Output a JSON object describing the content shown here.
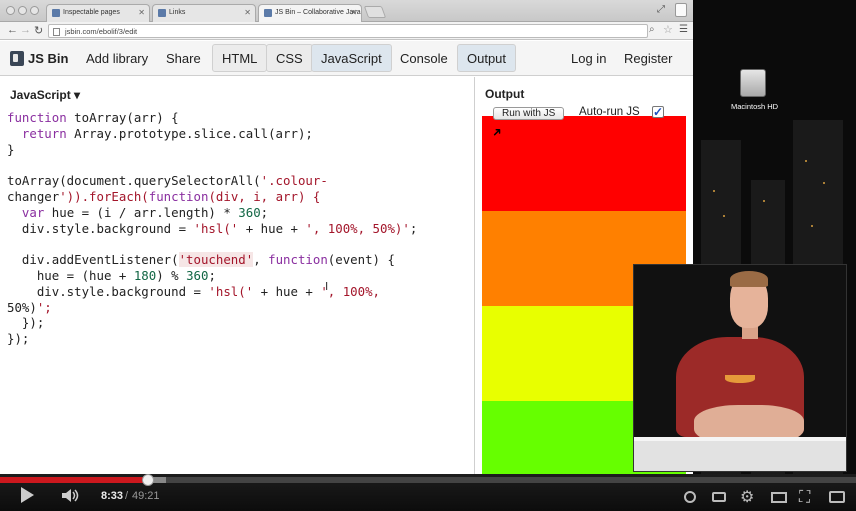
{
  "browser": {
    "tabs": [
      {
        "label": "Inspectable pages"
      },
      {
        "label": "Links"
      },
      {
        "label": "JS Bin – Collaborative Java"
      }
    ],
    "url": "jsbin.com/ebolif/3/edit"
  },
  "jsbin": {
    "logo": "JS Bin",
    "add_library": "Add library",
    "share": "Share",
    "panels": [
      "HTML",
      "CSS",
      "JavaScript",
      "Console",
      "Output"
    ],
    "active_panel": "JavaScript",
    "login": "Log in",
    "register": "Register"
  },
  "editor": {
    "label": "JavaScript ▾",
    "code_lines": [
      "function toArray(arr) {",
      "  return Array.prototype.slice.call(arr);",
      "}",
      "",
      "toArray(document.querySelectorAll('.colour-",
      "changer')).forEach(function(div, i, arr) {",
      "  var hue = (i / arr.length) * 360;",
      "  div.style.background = 'hsl(' + hue + ', 100%, 50%)';",
      "",
      "  div.addEventListener('touchend', function(event) {",
      "    hue = (hue + 180) % 360;",
      "    div.style.background = 'hsl(' + hue + ', 100%,",
      "50%)';",
      "  });",
      "});"
    ]
  },
  "output": {
    "label": "Output",
    "run_button": "Run with JS",
    "autorun_label": "Auto-run JS",
    "autorun_checked": true,
    "stripe_colors": [
      "#ff0000",
      "#ff8000",
      "#e8ff00",
      "#66ff00"
    ]
  },
  "desktop": {
    "drive_label": "Macintosh HD"
  },
  "video": {
    "current_time": "8:33",
    "separator": "/",
    "total_time": "49:21",
    "progress": 0.173,
    "accent_color": "#cc181e"
  }
}
